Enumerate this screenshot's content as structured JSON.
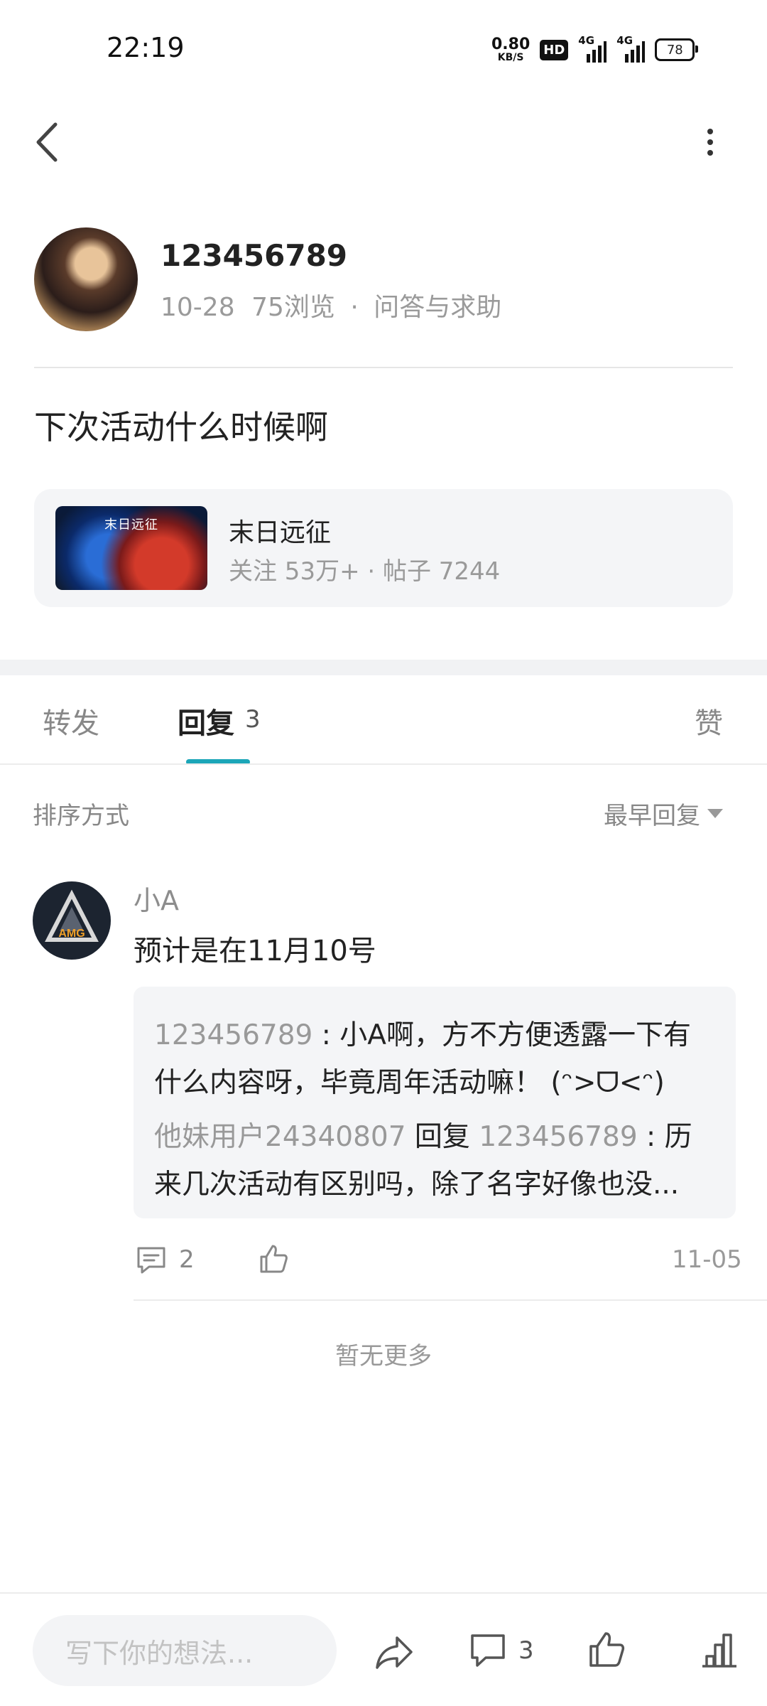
{
  "status_bar": {
    "time": "22:19",
    "speed_value": "0.80",
    "speed_unit": "KB/S",
    "hd_label": "HD",
    "network1": "4G",
    "network2": "4G",
    "battery": "78"
  },
  "post": {
    "author": "123456789",
    "date": "10-28",
    "views": "75浏览",
    "separator": "·",
    "category": "问答与求助",
    "title": "下次活动什么时候啊"
  },
  "game_card": {
    "name": "末日远征",
    "stats": "关注 53万+ · 帖子 7244",
    "thumb_logo": "末日远征"
  },
  "tabs": {
    "forward": "转发",
    "reply": "回复",
    "reply_count": "3",
    "like": "赞"
  },
  "sort": {
    "label": "排序方式",
    "selected": "最早回复"
  },
  "reply": {
    "author": "小A",
    "text": "预计是在11月10号",
    "quote1_user": "123456789",
    "quote1_line1": " : 小A啊，方不方便透露一下有",
    "quote1_line2": "什么内容呀，毕竟周年活动嘛！ (ᵔ>ᗜ<ᵔ)",
    "quote2_user": "他妹用户24340807",
    "quote2_reply": " 回复 ",
    "quote2_target": "123456789",
    "quote2_line1": " : 历",
    "quote2_line2": "来几次活动有区别吗，除了名字好像也没...",
    "comment_count": "2",
    "date": "11-05",
    "avatar_text": "AMG"
  },
  "no_more": "暂无更多",
  "bottom_bar": {
    "input_placeholder": "写下你的想法...",
    "comment_count": "3"
  },
  "colors": {
    "accent": "#1ca6b8",
    "muted": "#999999",
    "card_bg": "#f4f5f7"
  }
}
